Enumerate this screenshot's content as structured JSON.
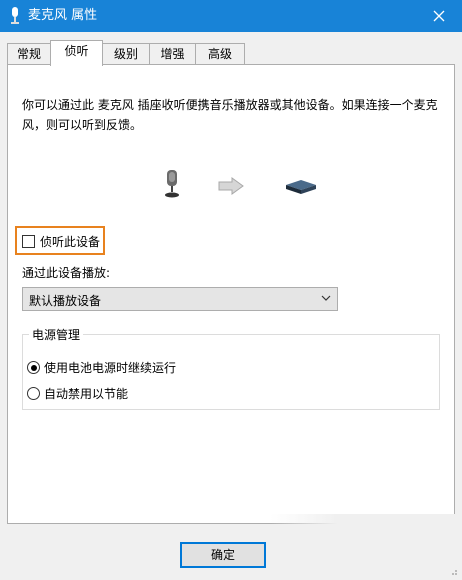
{
  "window": {
    "title": "麦克风 属性"
  },
  "tabs": [
    {
      "label": "常规"
    },
    {
      "label": "侦听",
      "active": true
    },
    {
      "label": "级别"
    },
    {
      "label": "增强"
    },
    {
      "label": "高级"
    }
  ],
  "listen": {
    "description": "你可以通过此 麦克风 插座收听便携音乐播放器或其他设备。如果连接一个麦克风，则可以听到反馈。",
    "checkbox_label": "侦听此设备",
    "checkbox_checked": false,
    "playback_label": "通过此设备播放:",
    "playback_device": "默认播放设备"
  },
  "power": {
    "legend": "电源管理",
    "options": [
      {
        "label": "使用电池电源时继续运行",
        "checked": true
      },
      {
        "label": "自动禁用以节能",
        "checked": false
      }
    ]
  },
  "buttons": {
    "ok": "确定"
  },
  "colors": {
    "titlebar": "#1883d7",
    "highlight": "#e8821e",
    "focus": "#0078d7"
  },
  "icons": [
    "microphone-icon",
    "arrow-right-icon",
    "speaker-device-icon",
    "close-icon",
    "chevron-down-icon"
  ]
}
